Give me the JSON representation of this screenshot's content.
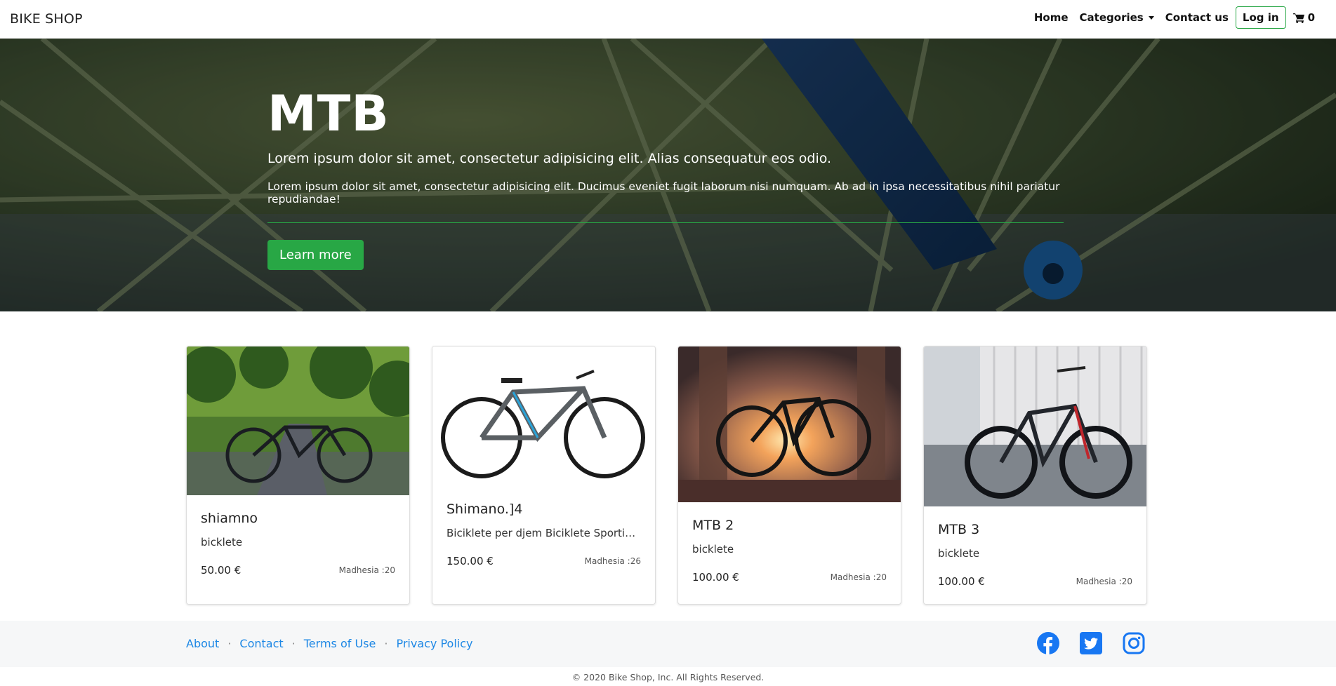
{
  "nav": {
    "brand": "BIKE SHOP",
    "links": [
      "Home",
      "Categories",
      "Contact us"
    ],
    "login": "Log in",
    "cart_count": "0"
  },
  "hero": {
    "title": "MTB",
    "lead": "Lorem ipsum dolor sit amet, consectetur adipisicing elit. Alias consequatur eos odio.",
    "text": "Lorem ipsum dolor sit amet, consectetur adipisicing elit. Ducimus eveniet fugit laborum nisi numquam. Ab ad in ipsa necessitatibus nihil pariatur repudiandae!",
    "button": "Learn more"
  },
  "products": [
    {
      "title": "shiamno",
      "description": "bicklete",
      "price": "50.00 €",
      "stock": "Madhesia :20"
    },
    {
      "title": "Shimano.]4",
      "description": "Biciklete per djem Biciklete Sportive ...",
      "price": "150.00 €",
      "stock": "Madhesia :26"
    },
    {
      "title": "MTB 2",
      "description": "bicklete",
      "price": "100.00 €",
      "stock": "Madhesia :20"
    },
    {
      "title": "MTB 3",
      "description": "bicklete",
      "price": "100.00 €",
      "stock": "Madhesia :20"
    }
  ],
  "footer": {
    "links": [
      "About",
      "Contact",
      "Terms of Use",
      "Privacy Policy"
    ],
    "separator": "·",
    "social": [
      "facebook-icon",
      "twitter-icon",
      "instagram-icon"
    ],
    "copyright": "© 2020 Bike Shop, Inc. All Rights Reserved."
  },
  "colors": {
    "accent_green": "#28a745",
    "link_blue": "#1e88e5",
    "social_blue": "#1877f2"
  }
}
